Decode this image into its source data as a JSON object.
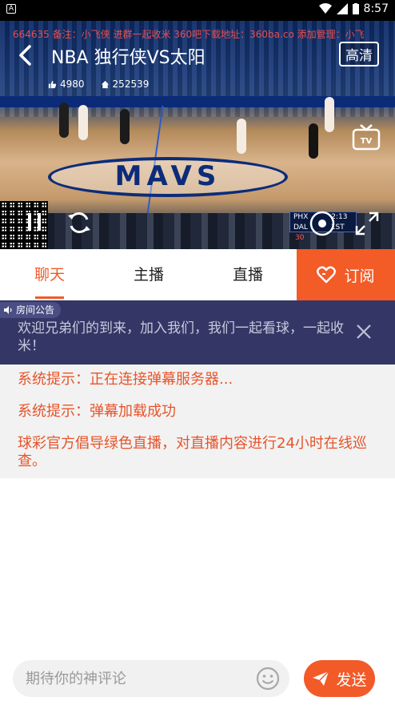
{
  "status_bar": {
    "time": "8:57",
    "notification_letter": "A"
  },
  "video": {
    "ticker": "664635  备注：小飞侠 进群一起收米    360吧下载地址：360ba.co 添加管理：小飞",
    "title": "NBA 独行侠VS太阳",
    "quality_button": "高清",
    "likes": "4980",
    "viewers": "252539",
    "court_text": "MAVS",
    "score_overlay": {
      "team1": "PHX",
      "team2": "DAL",
      "clock": "2:13",
      "period": "1ST",
      "score": "30"
    }
  },
  "tabs": {
    "items": [
      {
        "label": "聊天"
      },
      {
        "label": "主播"
      },
      {
        "label": "直播"
      }
    ],
    "subscribe_label": "订阅"
  },
  "announcement": {
    "label": "房间公告",
    "text": "欢迎兄弟们的到来，加入我们，我们一起看球，一起收米！"
  },
  "messages": [
    "系统提示：正在连接弹幕服务器...",
    "系统提示：弹幕加载成功",
    "球彩官方倡导绿色直播，对直播内容进行24小时在线巡查。"
  ],
  "input": {
    "placeholder": "期待你的神评论",
    "send_label": "发送"
  },
  "colors": {
    "accent": "#f35b27",
    "announcement_bg": "#343766",
    "message_text": "#e8542a"
  }
}
